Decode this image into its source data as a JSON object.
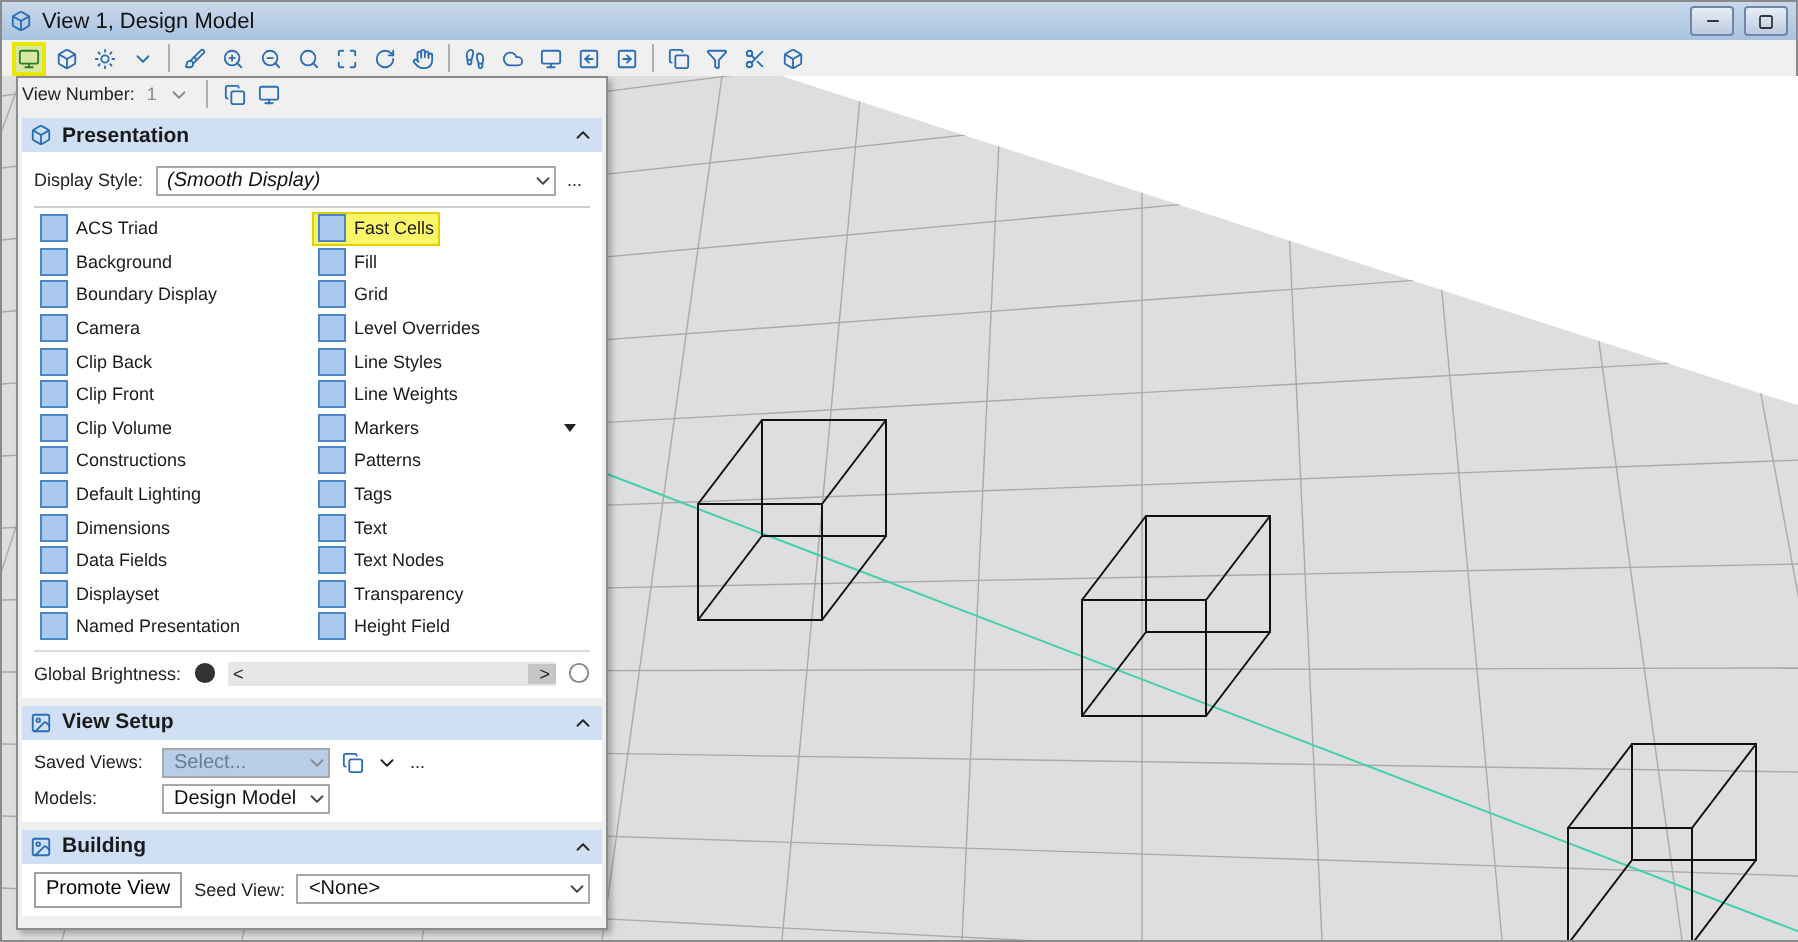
{
  "window": {
    "title": "View 1, Design Model"
  },
  "toolbar": {
    "view_attributes_highlighted": true
  },
  "panel": {
    "view_number_label": "View Number:",
    "view_number_value": "1",
    "presentation": {
      "title": "Presentation",
      "expanded": true,
      "display_style_label": "Display Style:",
      "display_style_value": "(Smooth Display)",
      "more": "...",
      "items": [
        {
          "label": "ACS Triad",
          "highlighted": false,
          "dropdown": false
        },
        {
          "label": "Background",
          "highlighted": false,
          "dropdown": false
        },
        {
          "label": "Boundary Display",
          "highlighted": false,
          "dropdown": false
        },
        {
          "label": "Camera",
          "highlighted": false,
          "dropdown": false
        },
        {
          "label": "Clip Back",
          "highlighted": false,
          "dropdown": false
        },
        {
          "label": "Clip Front",
          "highlighted": false,
          "dropdown": false
        },
        {
          "label": "Clip Volume",
          "highlighted": false,
          "dropdown": false
        },
        {
          "label": "Constructions",
          "highlighted": false,
          "dropdown": false
        },
        {
          "label": "Default Lighting",
          "highlighted": false,
          "dropdown": false
        },
        {
          "label": "Dimensions",
          "highlighted": false,
          "dropdown": false
        },
        {
          "label": "Data Fields",
          "highlighted": false,
          "dropdown": false
        },
        {
          "label": "Displayset",
          "highlighted": false,
          "dropdown": false
        },
        {
          "label": "Named Presentation",
          "highlighted": false,
          "dropdown": false
        },
        {
          "label": "Fast Cells",
          "highlighted": true,
          "dropdown": false
        },
        {
          "label": "Fill",
          "highlighted": false,
          "dropdown": false
        },
        {
          "label": "Grid",
          "highlighted": false,
          "dropdown": false
        },
        {
          "label": "Level Overrides",
          "highlighted": false,
          "dropdown": false
        },
        {
          "label": "Line Styles",
          "highlighted": false,
          "dropdown": false
        },
        {
          "label": "Line Weights",
          "highlighted": false,
          "dropdown": false
        },
        {
          "label": "Markers",
          "highlighted": false,
          "dropdown": true
        },
        {
          "label": "Patterns",
          "highlighted": false,
          "dropdown": false
        },
        {
          "label": "Tags",
          "highlighted": false,
          "dropdown": false
        },
        {
          "label": "Text",
          "highlighted": false,
          "dropdown": false
        },
        {
          "label": "Text Nodes",
          "highlighted": false,
          "dropdown": false
        },
        {
          "label": "Transparency",
          "highlighted": false,
          "dropdown": false
        },
        {
          "label": "Height Field",
          "highlighted": false,
          "dropdown": false
        }
      ],
      "brightness_label": "Global Brightness:",
      "brightness": {
        "level": 0.96,
        "left": "<",
        "right": ">"
      }
    },
    "view_setup": {
      "title": "View Setup",
      "expanded": true,
      "saved_views_label": "Saved Views:",
      "saved_views_placeholder": "Select...",
      "more": "...",
      "models_label": "Models:",
      "models_value": "Design Model"
    },
    "building": {
      "title": "Building",
      "expanded": true,
      "promote_button": "Promote View",
      "seed_view_label": "Seed View:",
      "seed_view_value": "<None>"
    }
  }
}
